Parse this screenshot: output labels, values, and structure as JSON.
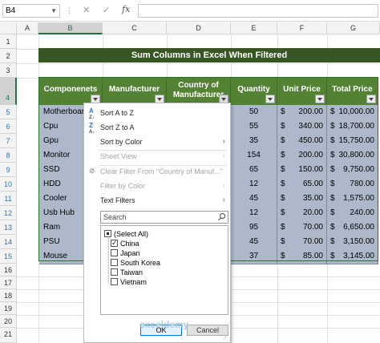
{
  "formula_bar": {
    "name_box": "B4",
    "cancel_symbol": "✕",
    "enter_symbol": "✓",
    "fx_label": "fx",
    "formula": ""
  },
  "columns": [
    "A",
    "B",
    "C",
    "D",
    "E",
    "F",
    "G"
  ],
  "rows": [
    "1",
    "2",
    "3",
    "4",
    "5",
    "6",
    "7",
    "8",
    "9",
    "10",
    "11",
    "12",
    "13",
    "14",
    "15",
    "16",
    "17",
    "18",
    "19",
    "20",
    "21"
  ],
  "title": "Sum  Columns in Excel When Filtered",
  "table": {
    "headers": [
      "Componenets",
      "Manufacturer",
      "Country of Manufacturer",
      "Quantity",
      "Unit Price",
      "Total Price"
    ],
    "rows": [
      [
        "Motherboard",
        "",
        "",
        "50",
        "$",
        "200.00",
        "$",
        "10,000.00"
      ],
      [
        "Cpu",
        "",
        "",
        "55",
        "$",
        "340.00",
        "$",
        "18,700.00"
      ],
      [
        "Gpu",
        "",
        "",
        "35",
        "$",
        "450.00",
        "$",
        "15,750.00"
      ],
      [
        "Monitor",
        "",
        "",
        "154",
        "$",
        "200.00",
        "$",
        "30,800.00"
      ],
      [
        "SSD",
        "",
        "",
        "65",
        "$",
        "150.00",
        "$",
        "9,750.00"
      ],
      [
        "HDD",
        "",
        "",
        "12",
        "$",
        "65.00",
        "$",
        "780.00"
      ],
      [
        "Cooler",
        "",
        "",
        "45",
        "$",
        "35.00",
        "$",
        "1,575.00"
      ],
      [
        "Usb Hub",
        "",
        "",
        "12",
        "$",
        "20.00",
        "$",
        "240.00"
      ],
      [
        "Ram",
        "",
        "",
        "95",
        "$",
        "70.00",
        "$",
        "6,650.00"
      ],
      [
        "PSU",
        "",
        "",
        "45",
        "$",
        "70.00",
        "$",
        "3,150.00"
      ],
      [
        "Mouse",
        "",
        "",
        "37",
        "$",
        "85.00",
        "$",
        "3,145.00"
      ]
    ]
  },
  "filter_menu": {
    "sort_az": "Sort A to Z",
    "sort_za": "Sort Z to A",
    "sort_by_color": "Sort by Color",
    "sheet_view": "Sheet View",
    "clear_filter": "Clear Filter From \"Country of  Manuf...\"",
    "filter_by_color": "Filter by Color",
    "text_filters": "Text Filters",
    "search_placeholder": "Search",
    "options": [
      {
        "label": "(Select All)",
        "state": "partial"
      },
      {
        "label": "China",
        "state": "checked"
      },
      {
        "label": "Japan",
        "state": "unchecked"
      },
      {
        "label": "South Korea",
        "state": "unchecked"
      },
      {
        "label": "Taiwan",
        "state": "unchecked"
      },
      {
        "label": "Vietnam",
        "state": "unchecked"
      }
    ],
    "ok": "OK",
    "cancel": "Cancel"
  },
  "watermark": "exceldemy"
}
